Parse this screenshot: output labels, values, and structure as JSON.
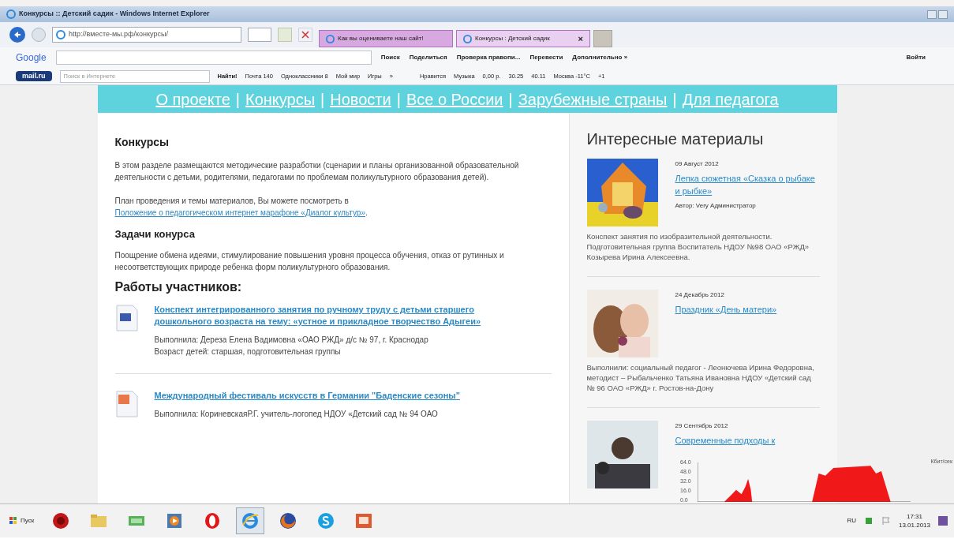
{
  "window": {
    "title": "Конкурсы :: Детский садик - Windows Internet Explorer"
  },
  "address_bar": {
    "url": "http://вместе-мы.рф/конкурсы/"
  },
  "tabs": [
    {
      "label": "Как вы оцениваете наш сайт!",
      "selected": false
    },
    {
      "label": "Конкурсы : Детский садик",
      "selected": true,
      "close": "×"
    }
  ],
  "google_toolbar": {
    "logo": "Google",
    "items": [
      "Поиск",
      "Поделиться",
      "Проверка правопи...",
      "Перевести",
      "Дополнительно »"
    ],
    "sign_in": "Войти"
  },
  "mail_toolbar": {
    "logo": "mail.ru",
    "search_placeholder": "Поиск в Интернете",
    "search_button": "Найти!",
    "items": [
      "Почта 140",
      "Одноклассники 8",
      "Мой мир",
      "Игры",
      "»",
      "Нравится",
      "Музыка",
      "0,00 р.",
      "30.25",
      "40.11",
      "Москва -11°C",
      "+1"
    ]
  },
  "site_nav": {
    "links": [
      "О проекте",
      "Конкурсы",
      "Новости",
      "Все о России",
      "Зарубежные страны",
      "Для педагога"
    ],
    "separator": "|"
  },
  "main": {
    "title": "Конкурсы",
    "intro": "В этом разделе размещаются методические разработки (сценарии и планы организованной образовательной деятельности с детьми, родителями, педагогами по проблемам поликультурного образования детей).",
    "plan_text": "План проведения и темы материалов, Вы можете посмотреть в",
    "plan_link": "Положение о педагогическом интернет марафоне «Диалог культур»",
    "plan_end": ".",
    "tasks_title": "Задачи конурса",
    "tasks_text": "Поощрение обмена идеями, стимулирование повышения уровня процесса обучения, отказ от рутинных и несоответствующих природе ребенка форм поликультурного образования.",
    "works_title": "Работы участников:",
    "works": [
      {
        "kind": "doc",
        "title": "Конспект интегрированного занятия по ручному труду с детьми старшего дошкольного возраста на тему: «устное и прикладное творчество Адыгеи»",
        "lines": [
          "Выполнила: Дереза Елена Вадимовна «ОАО РЖД» д/с № 97, г. Краснодар",
          "Возраст детей: старшая, подготовительная группы"
        ]
      },
      {
        "kind": "presentation",
        "title": "Международный фестиваль искусств в Германии \"Баденские сезоны\"",
        "lines": [
          "Выполнила: КориневскаяР.Г. учитель-логопед НДОУ «Детский сад № 94 ОАО"
        ]
      }
    ]
  },
  "sidebar": {
    "title": "Интересные материалы",
    "items": [
      {
        "date": "09 Август 2012",
        "title": "Лепка сюжетная «Сказка о рыбаке и рыбке»",
        "author_label": "Автор:",
        "author": "Very Администратор",
        "text": "Конспект занятия по изобразительной деятельности. Подготовительная группа Воспитатель НДОУ №98 ОАО «РЖД» Козырева Ирина Алексеевна."
      },
      {
        "date": "24 Декабрь 2012",
        "title": "Праздник «День матери»",
        "text": "Выполнили: социальный педагог - Леонючева Ирина Федоровна, методист – Рыбальченко Татьяна Ивановна НДОУ «Детский сад № 96 ОАО «РЖД» г. Ростов-на-Дону"
      },
      {
        "date": "29 Сентябрь 2012",
        "title": "Современные подходы к"
      }
    ]
  },
  "network_graph": {
    "y_labels": [
      "64.0",
      "48.0",
      "32.0",
      "16.0",
      "0.0"
    ],
    "unit": "Кбит/сек"
  },
  "taskbar": {
    "start": "Пуск",
    "apps": [
      {
        "kind": "red-circle",
        "selected": false
      },
      {
        "kind": "folder",
        "selected": false
      },
      {
        "kind": "green",
        "selected": false
      },
      {
        "kind": "player",
        "selected": false
      },
      {
        "kind": "opera",
        "selected": false
      },
      {
        "kind": "ie",
        "selected": true
      },
      {
        "kind": "firefox",
        "selected": false
      },
      {
        "kind": "skype",
        "selected": false
      },
      {
        "kind": "slides",
        "selected": false
      }
    ],
    "language": "RU",
    "time": "17:31",
    "date": "13.01.2013"
  }
}
